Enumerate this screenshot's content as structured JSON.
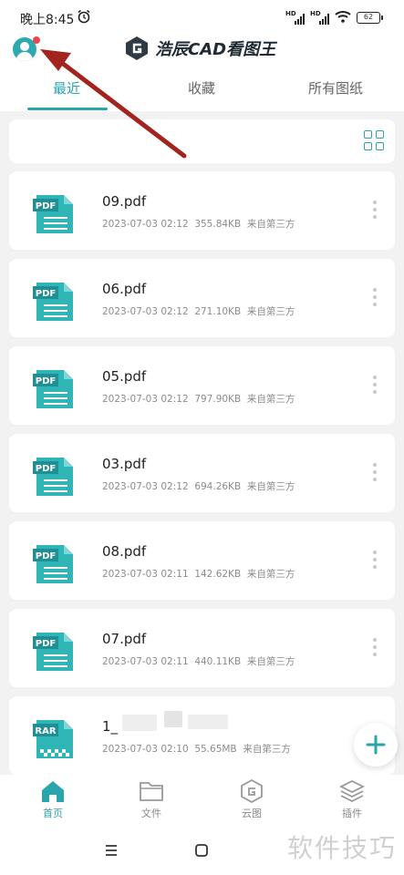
{
  "status": {
    "time": "晚上8:45",
    "hd_1": "HD",
    "hd_2": "HD",
    "battery": "62"
  },
  "header": {
    "app_title": "浩辰CAD看图王"
  },
  "tabs": [
    {
      "label": "最近",
      "active": true
    },
    {
      "label": "收藏",
      "active": false
    },
    {
      "label": "所有图纸",
      "active": false
    }
  ],
  "files": [
    {
      "type": "PDF",
      "name": "09.pdf",
      "date": "2023-07-03 02:12",
      "size": "355.84KB",
      "source": "来自第三方"
    },
    {
      "type": "PDF",
      "name": "06.pdf",
      "date": "2023-07-03 02:12",
      "size": "271.10KB",
      "source": "来自第三方"
    },
    {
      "type": "PDF",
      "name": "05.pdf",
      "date": "2023-07-03 02:12",
      "size": "797.90KB",
      "source": "来自第三方"
    },
    {
      "type": "PDF",
      "name": "03.pdf",
      "date": "2023-07-03 02:12",
      "size": "694.26KB",
      "source": "来自第三方"
    },
    {
      "type": "PDF",
      "name": "08.pdf",
      "date": "2023-07-03 02:11",
      "size": "142.62KB",
      "source": "来自第三方"
    },
    {
      "type": "PDF",
      "name": "07.pdf",
      "date": "2023-07-03 02:11",
      "size": "440.11KB",
      "source": "来自第三方"
    },
    {
      "type": "RAR",
      "name": "1_",
      "date": "2023-07-03 02:10",
      "size": "55.65MB",
      "source": "来自第三方"
    }
  ],
  "bottom_nav": [
    {
      "label": "首页",
      "icon": "home-icon",
      "active": true
    },
    {
      "label": "文件",
      "icon": "folder-icon",
      "active": false
    },
    {
      "label": "云图",
      "icon": "cloud-drawing-icon",
      "active": false
    },
    {
      "label": "插件",
      "icon": "layers-icon",
      "active": false
    }
  ],
  "watermark": "软件技巧",
  "colors": {
    "accent": "#2aa5ad",
    "avatar": "#2fa9b0",
    "notification_dot": "#e2484f",
    "annotation_arrow": "#a3231f"
  }
}
